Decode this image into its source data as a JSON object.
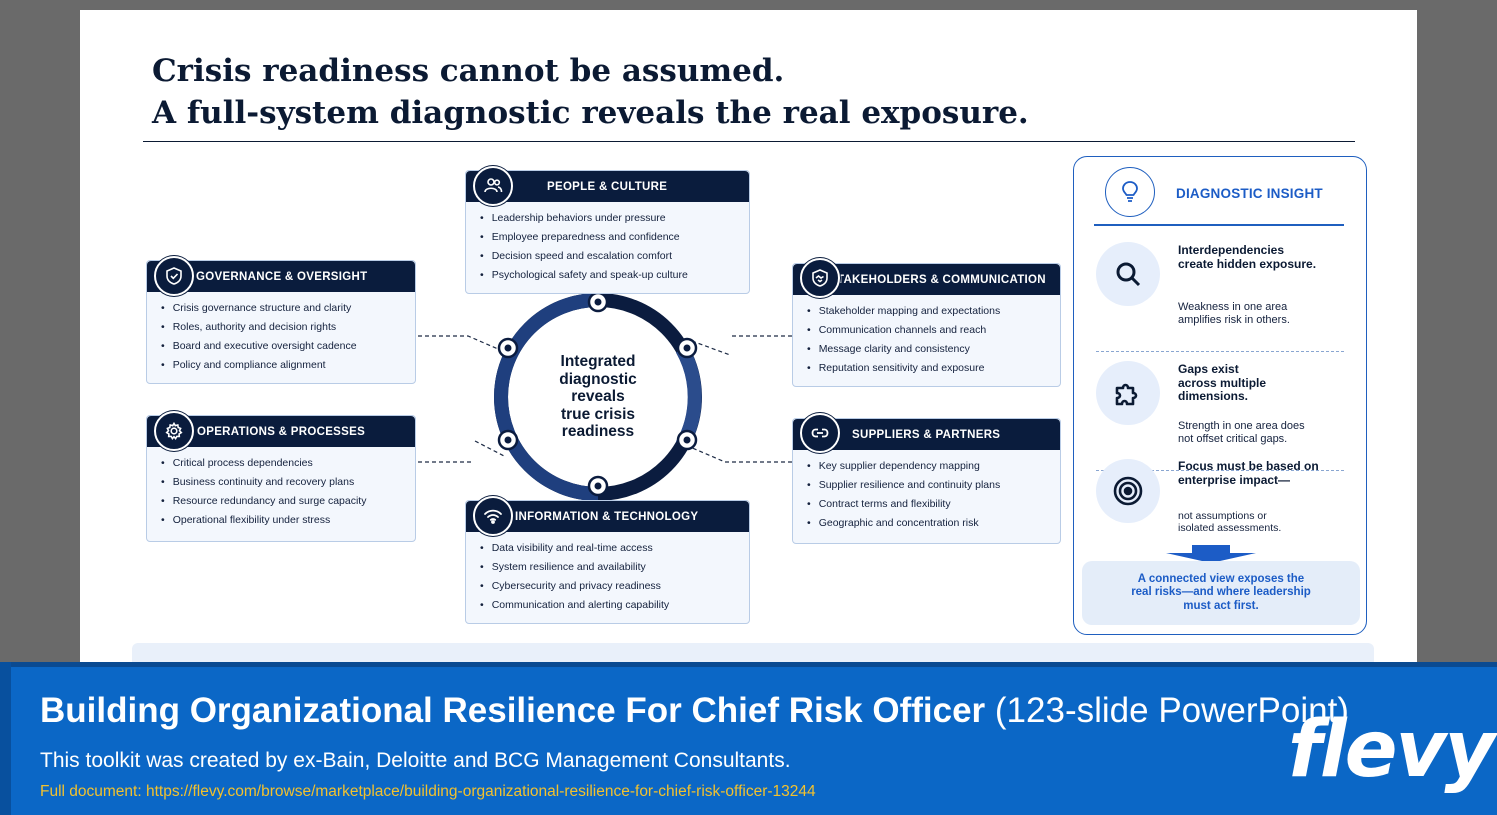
{
  "slide": {
    "title_line1": "Crisis readiness cannot be assumed.",
    "title_line2": "A full-system diagnostic reveals the real exposure.",
    "center_text": [
      "Integrated",
      "diagnostic",
      "reveals",
      "true crisis",
      "readiness"
    ]
  },
  "cards": {
    "people": {
      "title": "PEOPLE & CULTURE",
      "icon": "people-icon",
      "items": [
        "Leadership behaviors under pressure",
        "Employee preparedness and confidence",
        "Decision speed and escalation comfort",
        "Psychological safety and speak-up culture"
      ]
    },
    "governance": {
      "title": "GOVERNANCE & OVERSIGHT",
      "icon": "shield-check-icon",
      "items": [
        "Crisis governance structure and clarity",
        "Roles, authority and decision rights",
        "Board and executive oversight cadence",
        "Policy and compliance alignment"
      ]
    },
    "stakeholders": {
      "title": "STAKEHOLDERS & COMMUNICATION",
      "icon": "handshake-shield-icon",
      "items": [
        "Stakeholder mapping and expectations",
        "Communication channels and reach",
        "Message clarity and consistency",
        "Reputation sensitivity and exposure"
      ]
    },
    "operations": {
      "title": "OPERATIONS & PROCESSES",
      "icon": "gear-icon",
      "items": [
        "Critical process dependencies",
        "Business continuity and recovery plans",
        "Resource redundancy and surge capacity",
        "Operational flexibility under stress"
      ]
    },
    "suppliers": {
      "title": "SUPPLIERS & PARTNERS",
      "icon": "link-icon",
      "items": [
        "Key supplier dependency mapping",
        "Supplier resilience and continuity plans",
        "Contract terms and flexibility",
        "Geographic and concentration risk"
      ]
    },
    "technology": {
      "title": "INFORMATION & TECHNOLOGY",
      "icon": "wifi-icon",
      "items": [
        "Data visibility and real-time access",
        "System resilience and availability",
        "Cybersecurity and privacy readiness",
        "Communication and alerting capability"
      ]
    }
  },
  "insight": {
    "title": "DIAGNOSTIC INSIGHT",
    "icon": "lightbulb-icon",
    "points": [
      {
        "icon": "magnifier-icon",
        "head": [
          "Interdependencies",
          "create hidden exposure."
        ],
        "body": [
          "Weakness in one area",
          "amplifies risk in others."
        ]
      },
      {
        "icon": "puzzle-icon",
        "head": [
          "Gaps exist",
          "across multiple",
          "dimensions."
        ],
        "body": [
          "Strength in one area does",
          "not offset critical gaps."
        ]
      },
      {
        "icon": "target-icon",
        "head": [
          "Focus must be based on",
          "enterprise impact—"
        ],
        "body": [
          "not assumptions or",
          "isolated assessments."
        ]
      }
    ],
    "conclusion": [
      "A connected view exposes the",
      "real risks—and where leadership",
      "must act first."
    ]
  },
  "banner": {
    "title_bold": "Building Organizational Resilience For Chief Risk Officer",
    "title_light": "(123-slide PowerPoint)",
    "subtitle": "This toolkit was created by ex-Bain, Deloitte and BCG Management Consultants.",
    "link": "Full document: https://flevy.com/browse/marketplace/building-organizational-resilience-for-chief-risk-officer-13244",
    "logo": "flevy"
  },
  "colors": {
    "navy": "#0a1c3d",
    "accent_blue": "#1c5cc6",
    "banner_blue": "#0b67c6",
    "link_yellow": "#f2c12e"
  }
}
